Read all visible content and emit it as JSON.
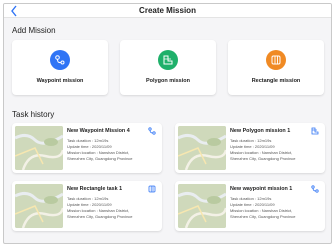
{
  "header": {
    "title": "Create Mission",
    "back_icon": "chevron-left-icon"
  },
  "add_mission": {
    "heading": "Add Mission",
    "cards": [
      {
        "label": "Waypoint mission",
        "icon": "waypoint-icon",
        "color": "#2f74f5"
      },
      {
        "label": "Polygon mission",
        "icon": "polygon-icon",
        "color": "#1fb06a"
      },
      {
        "label": "Rectangle mission",
        "icon": "rectangle-icon",
        "color": "#f08a24"
      }
    ]
  },
  "task_history": {
    "heading": "Task history",
    "items": [
      {
        "name": "New Waypoint Mission 4",
        "duration": "Task duration : 12m19s",
        "updated": "Update time : 2020/11/09",
        "location1": "Mission location : Nanshan District,",
        "location2": "Shenzhen City, Guangdong Province",
        "icon": "waypoint-type-icon"
      },
      {
        "name": "New Polygon mission 1",
        "duration": "Task duration : 12m19s",
        "updated": "Update time : 2020/11/09",
        "location1": "Mission location : Nanshan District,",
        "location2": "Shenzhen City, Guangdong Province",
        "icon": "polygon-type-icon"
      },
      {
        "name": "New Rectangle task 1",
        "duration": "Task duration : 12m19s",
        "updated": "Update time : 2020/11/09",
        "location1": "Mission location : Nanshan District,",
        "location2": "Shenzhen City, Guangdong Province",
        "icon": "rectangle-type-icon"
      },
      {
        "name": "New waypoint mission 1",
        "duration": "Task duration : 12m19s",
        "updated": "Update time : 2020/11/09",
        "location1": "Mission location : Nanshan District,",
        "location2": "Shenzhen City, Guangdong Province",
        "icon": "waypoint-type-icon"
      }
    ]
  },
  "colors": {
    "accent": "#2f74f5",
    "waypoint": "#2f74f5",
    "polygon": "#1fb06a",
    "rectangle": "#f08a24"
  }
}
